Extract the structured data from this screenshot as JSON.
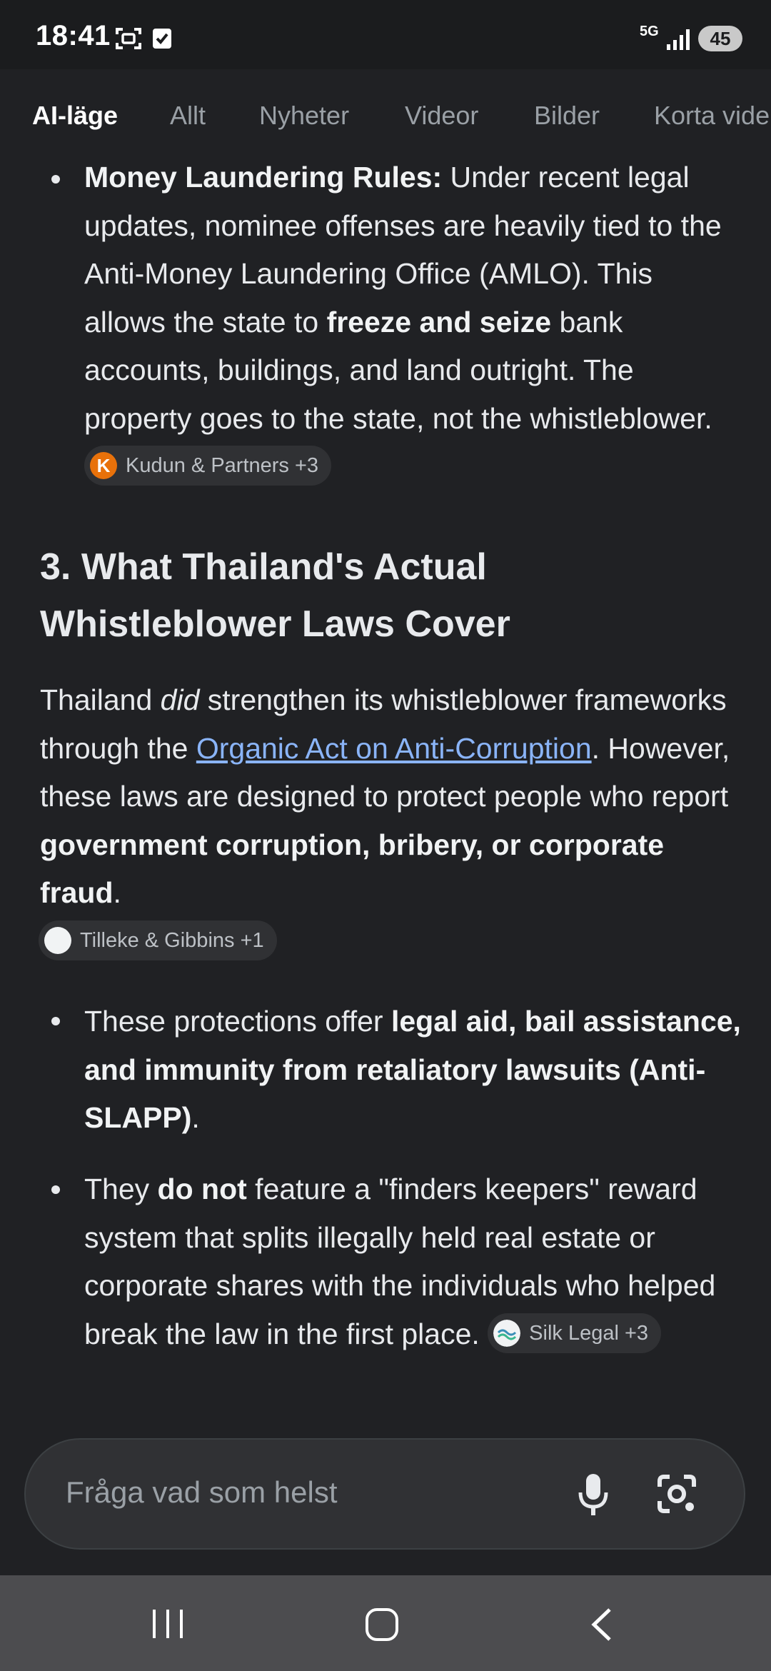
{
  "status_bar": {
    "time": "18:41",
    "network": "5G",
    "battery": "45"
  },
  "tabs": [
    "AI-läge",
    "Allt",
    "Nyheter",
    "Videor",
    "Bilder",
    "Korta vide"
  ],
  "section_top": {
    "bullet_title": "Money Laundering Rules:",
    "bullet_text_1": " Under recent legal updates, nominee offenses are heavily tied to the Anti-Money Laundering Office (AMLO). This allows the state to ",
    "bullet_bold_2": "freeze and seize",
    "bullet_text_3": " bank accounts, buildings, and land outright. The property goes to the state, not the whistleblower. ",
    "chip": "Kudun & Partners +3"
  },
  "heading": "3. What Thailand's Actual Whistleblower Laws Cover",
  "paragraph": {
    "t1": "Thailand ",
    "t2_italic": "did",
    "t3": " strengthen its whistleblower frameworks through the ",
    "link": "Organic Act on Anti-Corruption",
    "t4": ". However, these laws are designed to protect people who report ",
    "t5_bold": "government corruption, bribery, or corporate fraud",
    "t6": ".",
    "chip": "Tilleke & Gibbins +1"
  },
  "bullets": [
    {
      "t1": "These protections offer ",
      "bold": "legal aid, bail assistance, and immunity from retaliatory lawsuits (Anti-SLAPP)",
      "t2": "."
    },
    {
      "t1": "They ",
      "bold": "do not",
      "t2": " feature a \"finders keepers\" reward system that splits illegally held real estate or corporate shares with the individuals who helped break the law in the first place. ",
      "chip": "Silk Legal +3"
    }
  ],
  "search": {
    "placeholder": "Fråga vad som helst"
  },
  "icons": [
    "screenshot-icon",
    "check-icon",
    "signal-icon",
    "mic-icon",
    "lens-icon",
    "recent-apps-icon",
    "home-icon",
    "back-icon"
  ]
}
